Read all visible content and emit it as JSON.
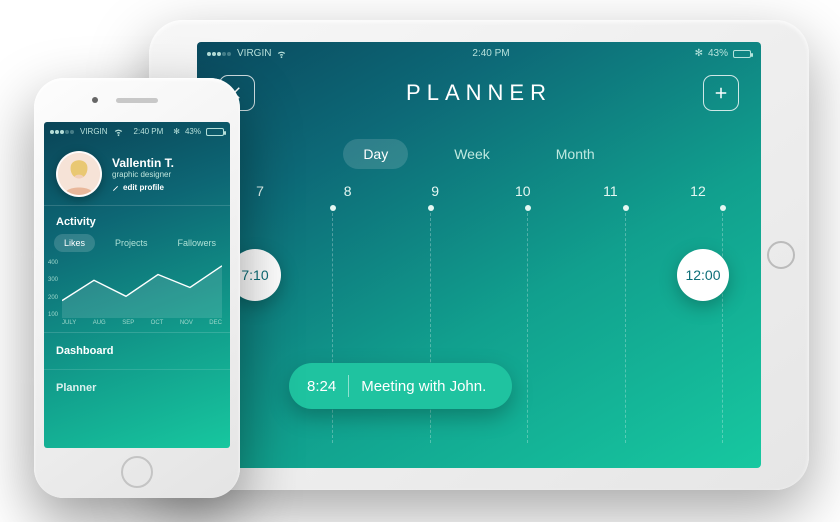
{
  "tablet": {
    "status": {
      "carrier": "VIRGIN",
      "time": "2:40 PM",
      "battery_pct": "43%",
      "battery_fill": 43
    },
    "title": "PLANNER",
    "view_tabs": {
      "day": "Day",
      "week": "Week",
      "month": "Month"
    },
    "hours": [
      "7",
      "8",
      "9",
      "10",
      "11",
      "12"
    ],
    "bubble1": "7:10",
    "bubble2": "12:00",
    "event": {
      "time": "8:24",
      "title": "Meeting with John."
    }
  },
  "phone": {
    "status": {
      "carrier": "VIRGIN",
      "time": "2:40 PM",
      "battery_pct": "43%",
      "battery_fill": 43
    },
    "profile": {
      "name": "Vallentin T.",
      "role": "graphic designer",
      "edit": "edit profile"
    },
    "activity": {
      "title": "Activity",
      "tabs": {
        "likes": "Likes",
        "projects": "Projects",
        "followers": "Fallowers"
      }
    },
    "menu": {
      "dashboard": "Dashboard",
      "planner": "Planner"
    }
  },
  "chart_data": {
    "type": "line",
    "categories": [
      "JULY",
      "AUG",
      "SEP",
      "OCT",
      "NOV",
      "DEC"
    ],
    "values": [
      120,
      260,
      150,
      300,
      210,
      360
    ],
    "ylabels": [
      "400",
      "300",
      "200",
      "100"
    ],
    "ylim": [
      0,
      400
    ],
    "title": "",
    "xlabel": "",
    "ylabel": ""
  }
}
